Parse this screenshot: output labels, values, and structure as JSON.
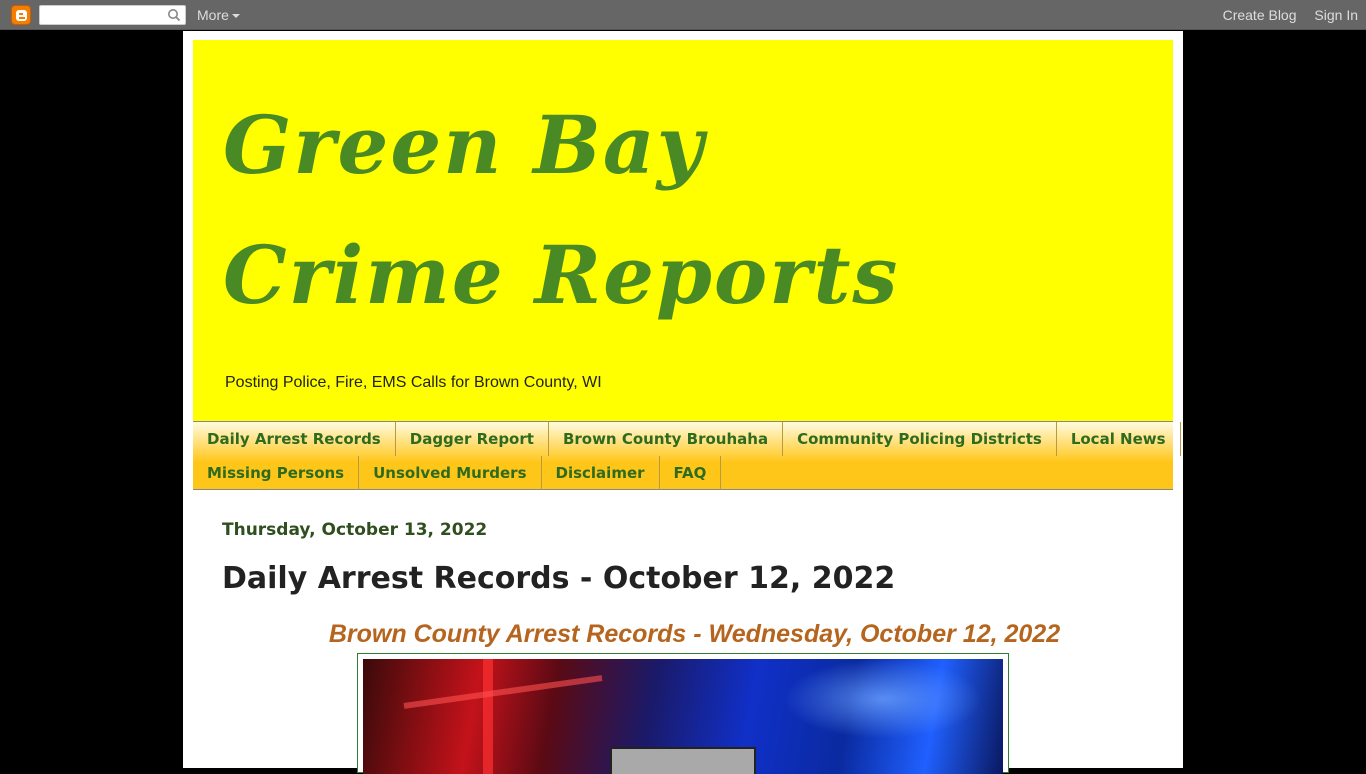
{
  "navbar": {
    "more_label": "More",
    "create_blog": "Create Blog",
    "sign_in": "Sign In",
    "search_value": ""
  },
  "header": {
    "title": "Green Bay Crime Reports",
    "description": "Posting Police, Fire, EMS Calls for Brown County, WI"
  },
  "tabs": {
    "row1": [
      "Daily Arrest Records",
      "Dagger Report",
      "Brown County Brouhaha",
      "Community Policing Districts",
      "Local News"
    ],
    "row2": [
      "Missing Persons",
      "Unsolved Murders",
      "Disclaimer",
      "FAQ"
    ]
  },
  "post": {
    "date": "Thursday, October 13, 2022",
    "title": "Daily Arrest Records - October 12, 2022",
    "subtitle": "Brown County Arrest Records - Wednesday, October 12, 2022"
  },
  "colors": {
    "header_bg": "#ffff00",
    "title_green": "#4a8a24",
    "subtitle_orange": "#b5651d",
    "tab_text": "#2f6b1f"
  }
}
